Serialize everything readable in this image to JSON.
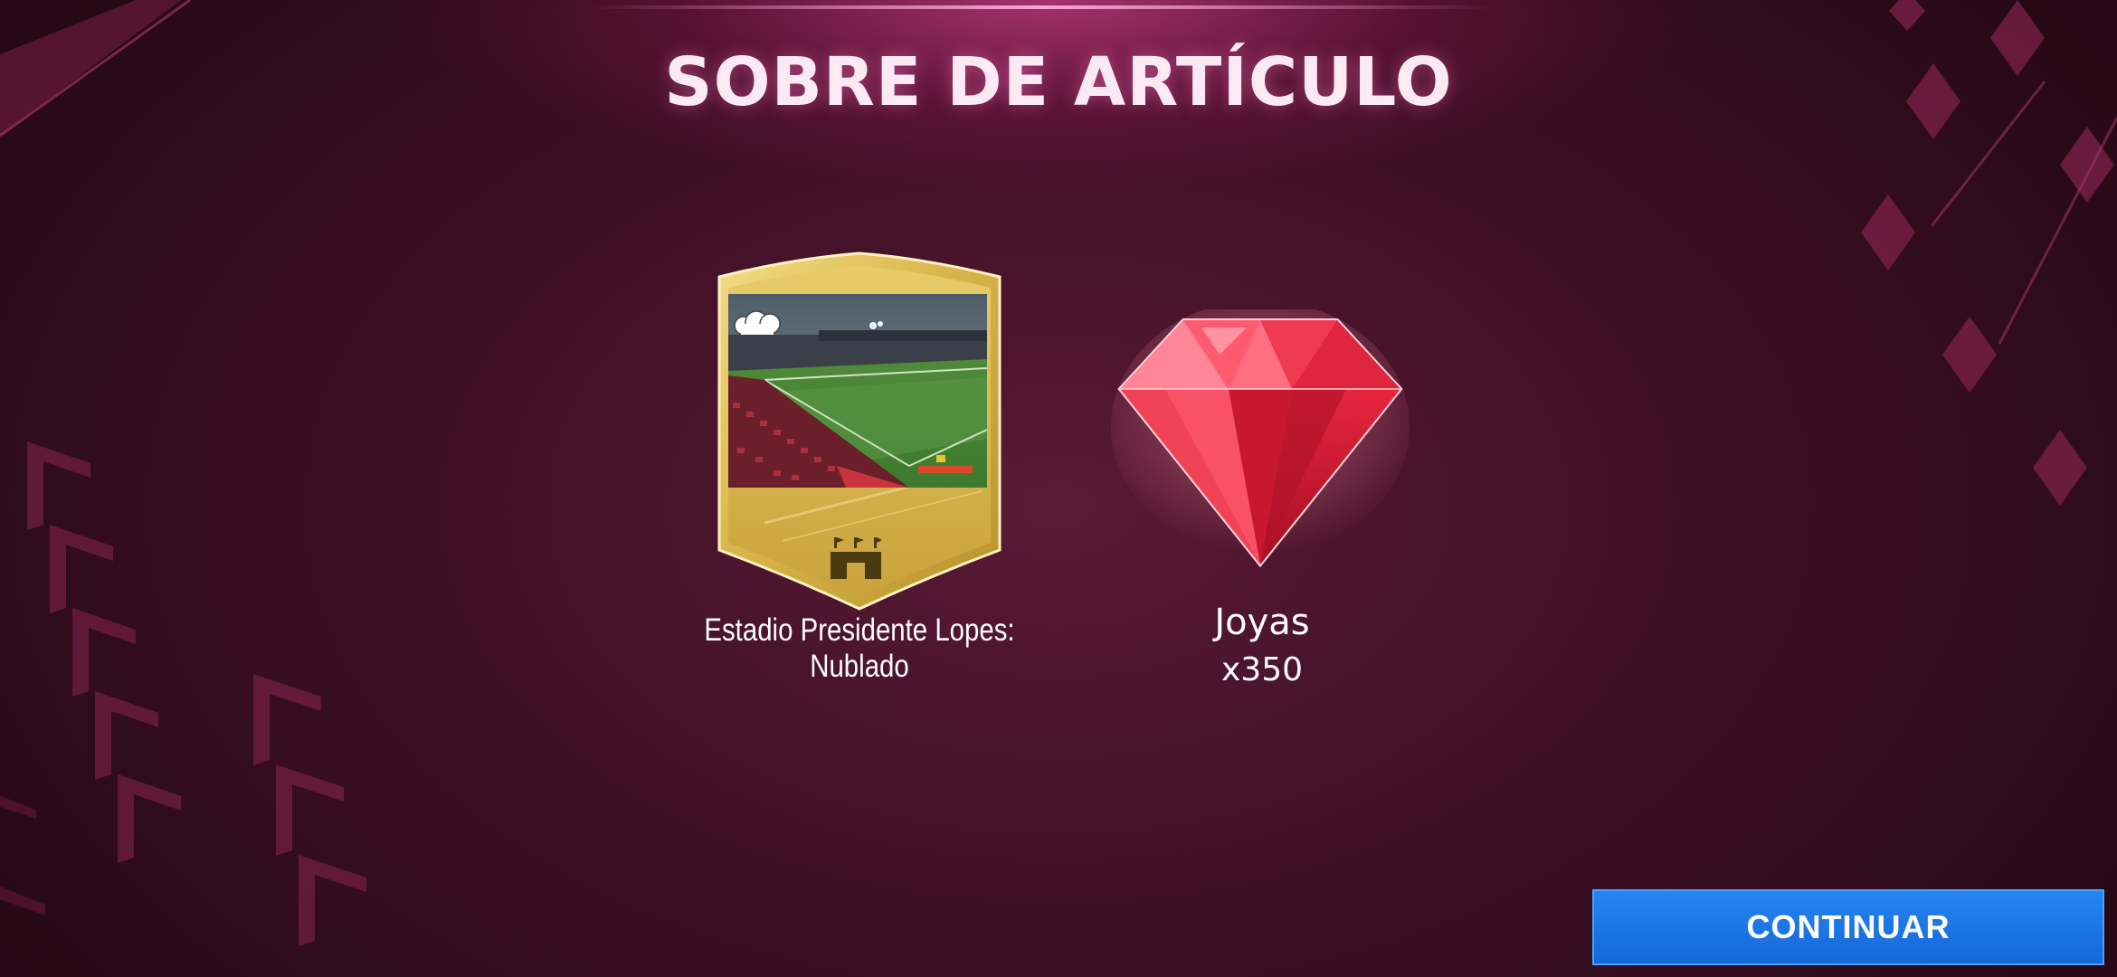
{
  "screen": {
    "title": "SOBRE DE ARTÍCULO"
  },
  "rewards": [
    {
      "type": "stadium-card",
      "label": "Estadio Presidente Lopes: Nublado",
      "weather_icon": "cloud-icon",
      "category_icon": "stadium-icon",
      "card_color": "#d9b84a"
    },
    {
      "type": "gems",
      "name": "Joyas",
      "quantity": "x350",
      "icon": "ruby-gem-icon",
      "gem_color": "#e8203a"
    }
  ],
  "actions": {
    "continue_label": "CONTINUAR",
    "continue_color": "#1a74e6"
  }
}
